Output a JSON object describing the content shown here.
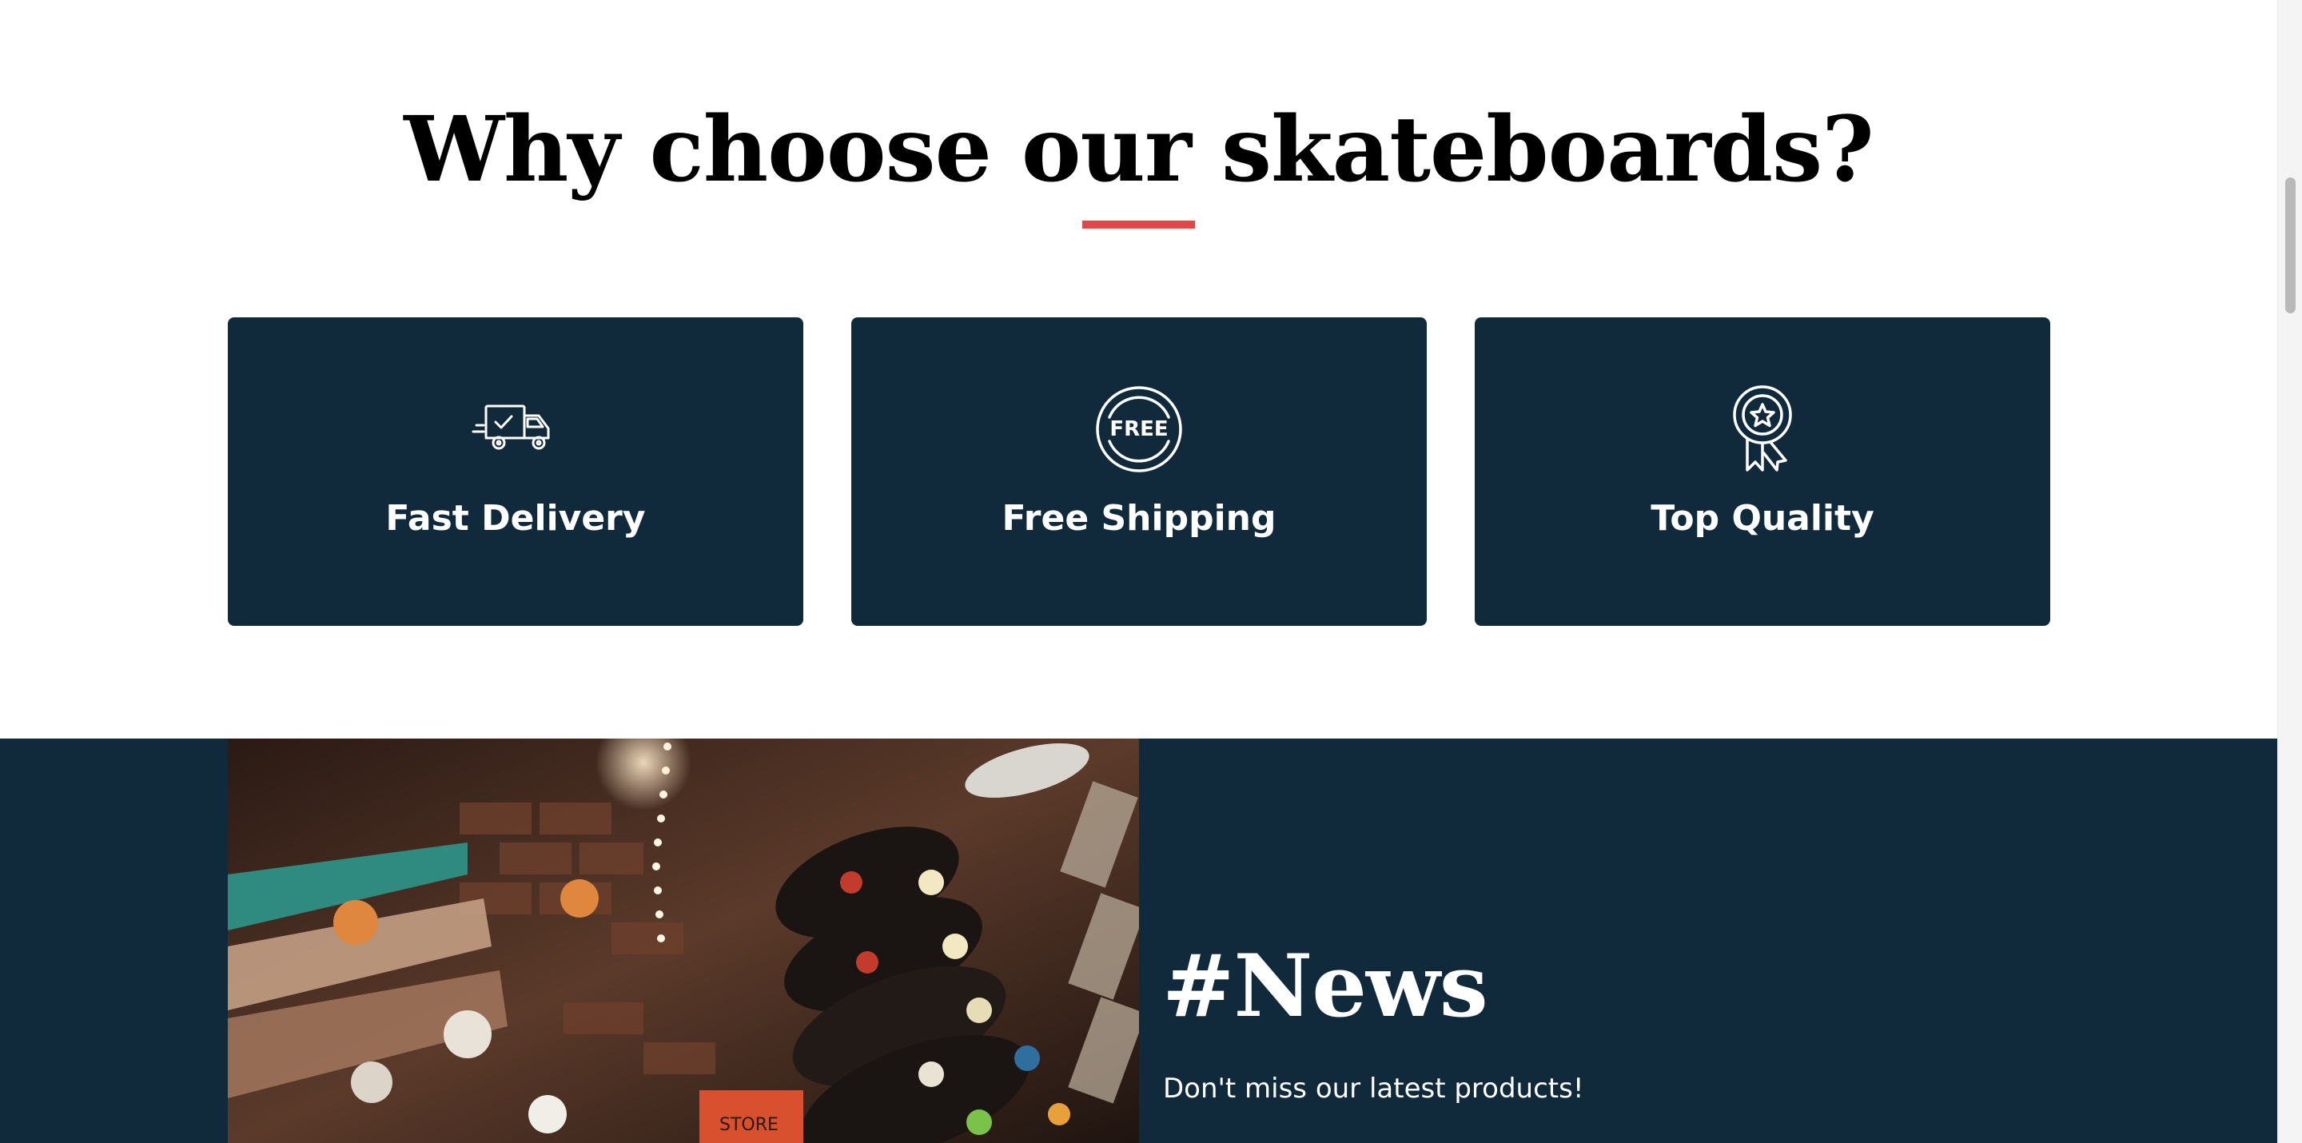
{
  "features": {
    "title": "Why choose our skateboards?",
    "accent_color": "#e04848",
    "card_color": "#10293b",
    "cards": [
      {
        "label": "Fast Delivery",
        "icon": "delivery-truck-icon"
      },
      {
        "label": "Free Shipping",
        "icon": "free-badge-icon",
        "icon_text": "FREE"
      },
      {
        "label": "Top Quality",
        "icon": "award-ribbon-icon"
      }
    ]
  },
  "news": {
    "title": "#News",
    "subtitle": "Don't miss our latest products!",
    "image": "skateboard-shop-wall-photo",
    "box_label": "STORE"
  }
}
